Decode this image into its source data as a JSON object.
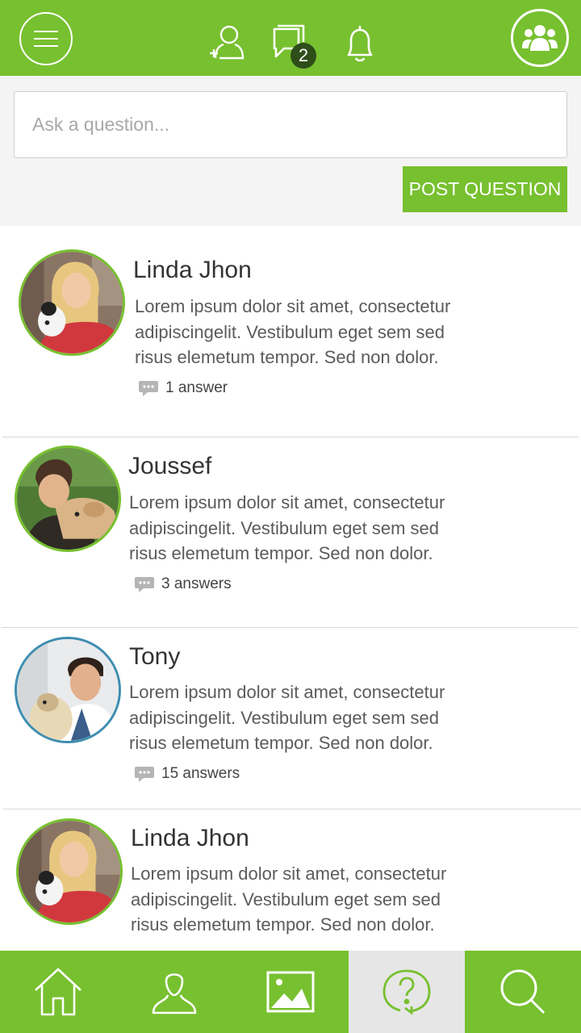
{
  "header": {
    "menu_icon": "hamburger-icon",
    "icons": [
      "add-friend-icon",
      "messages-icon",
      "bell-icon",
      "group-icon"
    ],
    "message_count": "2"
  },
  "ask": {
    "placeholder": "Ask a question...",
    "post_label": "POST QUESTION"
  },
  "questions": [
    {
      "name": "Linda Jhon",
      "text": "Lorem ipsum dolor sit amet, consectetur adipiscingelit. Vestibulum eget sem sed risus elemetum tempor. Sed non dolor.",
      "answers": "1 answer"
    },
    {
      "name": "Joussef",
      "text": "Lorem ipsum dolor sit amet, consectetur adipiscingelit. Vestibulum eget sem sed risus elemetum tempor. Sed non dolor.",
      "answers": "3 answers"
    },
    {
      "name": "Tony",
      "text": "Lorem ipsum dolor sit amet, consectetur adipiscingelit. Vestibulum eget sem sed risus elemetum tempor. Sed non dolor.",
      "answers": "15 answers"
    },
    {
      "name": "Linda Jhon",
      "text": "Lorem ipsum dolor sit amet, consectetur adipiscingelit. Vestibulum eget sem sed risus elemetum tempor. Sed non dolor."
    }
  ],
  "bottom_nav": {
    "items": [
      "home-icon",
      "profile-icon",
      "gallery-icon",
      "question-icon",
      "search-icon"
    ],
    "active": "question-icon"
  },
  "colors": {
    "brand_green": "#77c02f",
    "badge_dark": "#2e4d19",
    "avatar_blue_ring": "#3d8db0",
    "active_tab_bg": "#e6e6e6"
  }
}
